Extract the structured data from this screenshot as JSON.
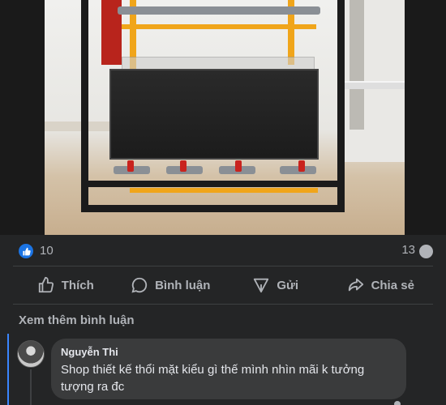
{
  "post": {
    "photo": {
      "alt_icon": "product-photo"
    },
    "reactions": {
      "like_icon": "thumbs-up-icon",
      "like_color": "#1b74e4",
      "like_count": "10",
      "comment_count": "13",
      "comment_icon": "comment-bubble-icon"
    },
    "actions": [
      {
        "label": "Thích",
        "icon": "thumbs-up-icon"
      },
      {
        "label": "Bình luận",
        "icon": "comment-icon"
      },
      {
        "label": "Gửi",
        "icon": "send-icon"
      },
      {
        "label": "Chia sẻ",
        "icon": "share-icon"
      }
    ]
  },
  "comments": {
    "more_label": "Xem thêm bình luận",
    "items": [
      {
        "author": "Nguyễn Thi",
        "text": "Shop thiết kế thổi mặt kiểu gì thế mình nhìn mãi k tưởng tượng ra đc"
      }
    ]
  },
  "colors": {
    "background": "#242526",
    "bubble": "#3a3b3c",
    "secondary_text": "#b0b3b8",
    "primary_text": "#e4e6eb",
    "thread_accent": "#3a86ff"
  }
}
